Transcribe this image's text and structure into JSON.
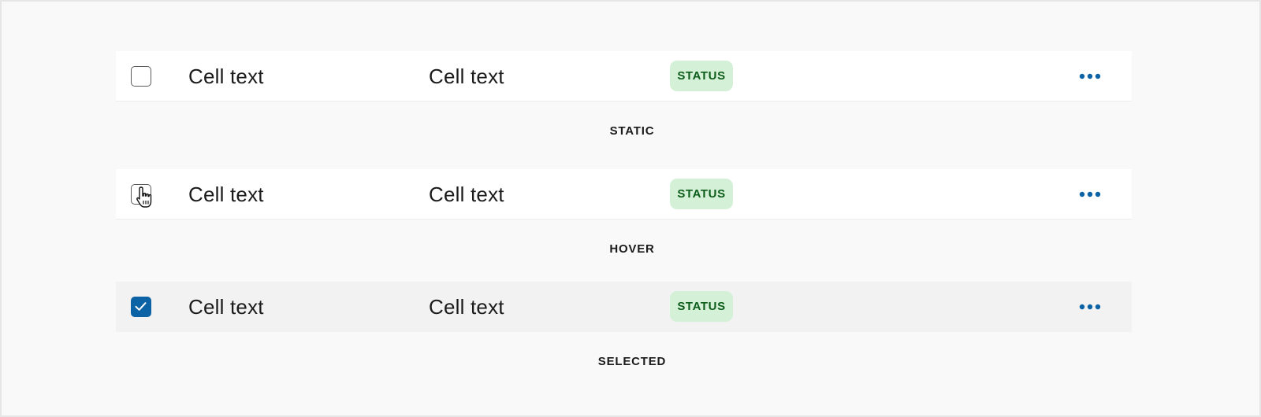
{
  "colors": {
    "background": "#f9f9f9",
    "row_bg": "#ffffff",
    "row_selected_bg": "#f2f2f2",
    "checkbox_checked": "#0b62a4",
    "badge_bg": "#d4f1d8",
    "badge_text": "#0d5c1a",
    "more_icon": "#0b62a4"
  },
  "rows": [
    {
      "state": "static",
      "checked": false,
      "cells": [
        "Cell text",
        "Cell text"
      ],
      "status": "STATUS",
      "state_label": "STATIC",
      "icons": {
        "checkbox": "checkbox-empty-icon",
        "more": "more-horizontal-icon"
      }
    },
    {
      "state": "hover",
      "checked": false,
      "cells": [
        "Cell text",
        "Cell text"
      ],
      "status": "STATUS",
      "state_label": "HOVER",
      "icons": {
        "checkbox": "checkbox-empty-icon",
        "cursor": "hand-pointer-cursor-icon",
        "more": "more-horizontal-icon"
      }
    },
    {
      "state": "selected",
      "checked": true,
      "cells": [
        "Cell text",
        "Cell text"
      ],
      "status": "STATUS",
      "state_label": "SELECTED",
      "icons": {
        "checkbox": "checkbox-checked-icon",
        "more": "more-horizontal-icon"
      }
    }
  ]
}
